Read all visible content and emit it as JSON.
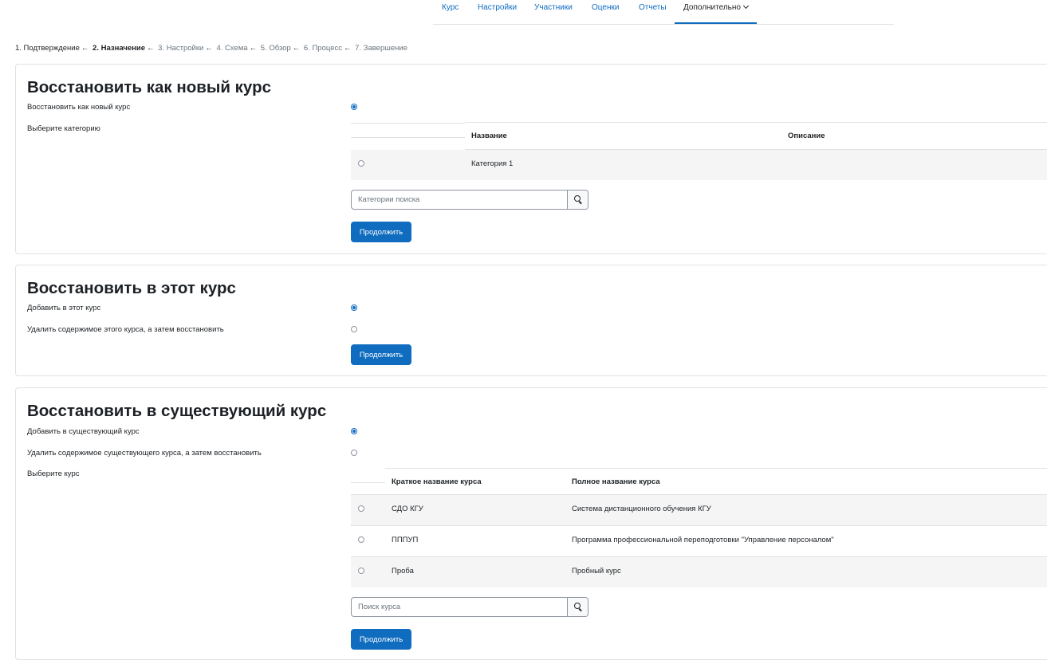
{
  "nav": {
    "items": [
      "Курс",
      "Настройки",
      "Участники",
      "Оценки",
      "Отчеты"
    ],
    "more_label": "Дополнительно"
  },
  "steps": {
    "s1": "1. Подтверждение",
    "s2": "2. Назначение",
    "s3": "3. Настройки",
    "s4": "4. Схема",
    "s5": "5. Обзор",
    "s6": "6. Процесс",
    "s7": "7. Завершение",
    "arrow": "←"
  },
  "section_new": {
    "title": "Восстановить как новый курс",
    "option_label": "Восстановить как новый курс",
    "category_label": "Выберите категорию",
    "col_name": "Название",
    "col_desc": "Описание",
    "rows": [
      {
        "name": "Категория 1",
        "desc": ""
      }
    ],
    "search_placeholder": "Категории поиска",
    "continue": "Продолжить"
  },
  "section_this": {
    "title": "Восстановить в этот курс",
    "option_add": "Добавить в этот курс",
    "option_delete": "Удалить содержимое этого курса, а затем восстановить",
    "continue": "Продолжить"
  },
  "section_existing": {
    "title": "Восстановить в существующий курс",
    "option_add": "Добавить в существующий курс",
    "option_delete": "Удалить содержимое существующего курса, а затем восстановить",
    "course_label": "Выберите курс",
    "col_short": "Краткое название курса",
    "col_full": "Полное название курса",
    "rows": [
      {
        "short": "СДО КГУ",
        "full": "Система дистанционного обучения КГУ"
      },
      {
        "short": "ПППУП",
        "full": "Программа профессиональной переподготовки \"Управление персоналом\""
      },
      {
        "short": "Проба",
        "full": "Пробный курс"
      }
    ],
    "search_placeholder": "Поиск курса",
    "continue": "Продолжить"
  },
  "colors": {
    "accent": "#0f6cbf",
    "row_stripe": "#f5f5f5"
  }
}
